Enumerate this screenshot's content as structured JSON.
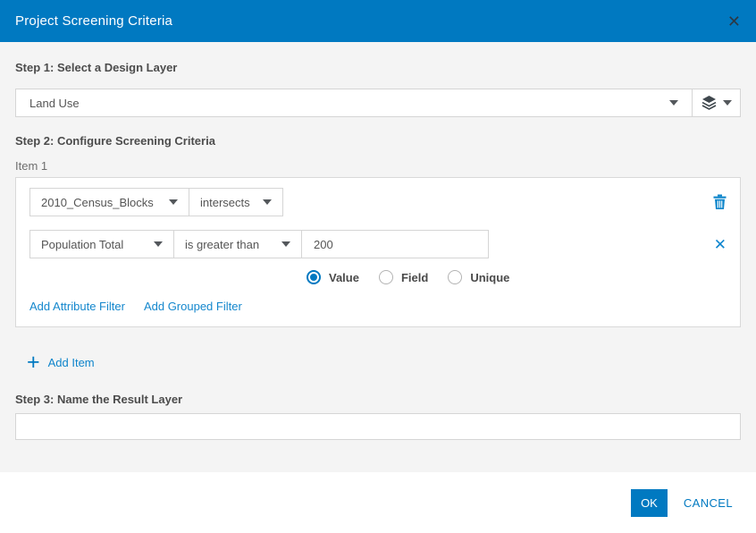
{
  "dialog": {
    "title": "Project Screening Criteria"
  },
  "icons": {
    "close": "✕",
    "remove": "✕",
    "plus": "+"
  },
  "step1": {
    "heading": "Step 1: Select a Design Layer",
    "selected_layer": "Land Use"
  },
  "step2": {
    "heading": "Step 2: Configure Screening Criteria",
    "item_label": "Item 1"
  },
  "item": {
    "criteria_layer": "2010_Census_Blocks",
    "spatial_operator": "intersects",
    "attribute_field": "Population Total",
    "attribute_operator": "is greater than",
    "attribute_value": "200",
    "radios": [
      {
        "label": "Value",
        "selected": true
      },
      {
        "label": "Field",
        "selected": false
      },
      {
        "label": "Unique",
        "selected": false
      }
    ],
    "links": {
      "add_attribute": "Add Attribute Filter",
      "add_grouped": "Add Grouped Filter"
    }
  },
  "add_item_label": "Add Item",
  "step3": {
    "heading": "Step 3: Name the Result Layer",
    "value": "",
    "placeholder": ""
  },
  "footer": {
    "ok": "OK",
    "cancel": "CANCEL"
  },
  "colors": {
    "accent": "#0079c1",
    "header_bg": "#0079c1",
    "body_bg": "#f4f4f4",
    "border": "#d5d5d5",
    "heading_text": "#4c4c4c",
    "link_blue": "#1487cd"
  }
}
